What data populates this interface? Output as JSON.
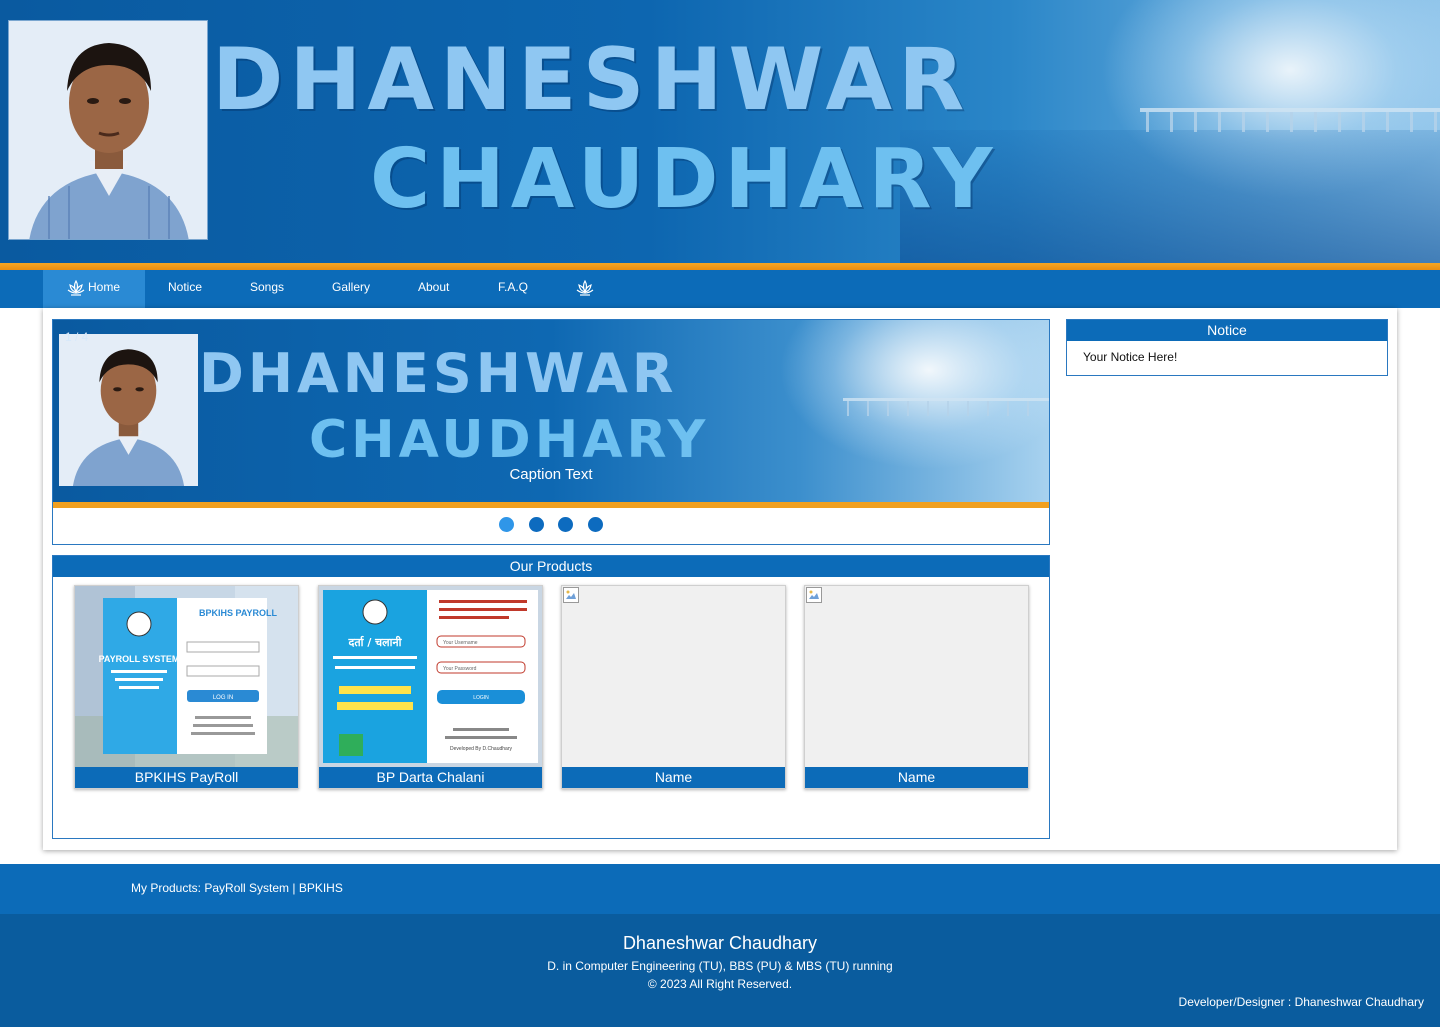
{
  "header": {
    "title_line1": "DHANESHWAR",
    "title_line2": "CHAUDHARY",
    "colors": {
      "banner": "#0c6bb8",
      "accent_orange": "#f0a020",
      "title_text": "#8fc7f2"
    }
  },
  "nav": {
    "items": [
      {
        "label": "Home",
        "icon": "lotus-icon",
        "active": true
      },
      {
        "label": "Notice"
      },
      {
        "label": "Songs"
      },
      {
        "label": "Gallery"
      },
      {
        "label": "About"
      },
      {
        "label": "F.A.Q"
      },
      {
        "label": "",
        "icon": "lotus-icon"
      }
    ]
  },
  "slider": {
    "counter": "1 / 4",
    "caption": "Caption Text",
    "title_line1": "DHANESHWAR",
    "title_line2": "CHAUDHARY",
    "dot_count": 4,
    "active_dot": 1
  },
  "notice": {
    "heading": "Notice",
    "text": "Your Notice Here!"
  },
  "products": {
    "heading": "Our Products",
    "items": [
      {
        "name": "BPKIHS PayRoll",
        "thumb": "payroll-screenshot",
        "thumb_title": "PAYROLL SYSTEM",
        "brand": "BPKIHS PAYROLL",
        "button": "LOG IN"
      },
      {
        "name": "BP Darta Chalani",
        "thumb": "darta-chalani-screenshot",
        "thumb_title": "दर्ता / चलानी",
        "field1": "Your Username",
        "field2": "Your Password",
        "button": "LOGIN",
        "developer": "Developed By D.Chaudhary"
      },
      {
        "name": "Name",
        "thumb": "broken-image"
      },
      {
        "name": "Name",
        "thumb": "broken-image"
      }
    ]
  },
  "footer": {
    "links_text": "My Products: PayRoll System | BPKIHS",
    "name": "Dhaneshwar Chaudhary",
    "education": "D. in Computer Engineering (TU), BBS (PU) & MBS (TU) running",
    "copyright": "© 2023 All Right Reserved.",
    "developer": "Developer/Designer : Dhaneshwar Chaudhary"
  }
}
